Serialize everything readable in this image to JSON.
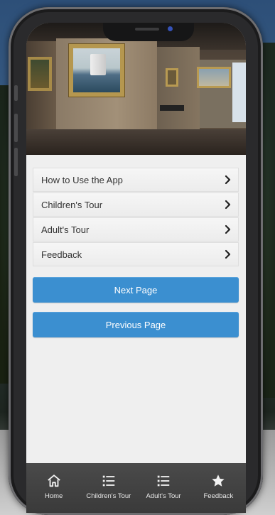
{
  "menu": {
    "items": [
      {
        "label": "How to Use the App",
        "icon": "chevron-right-icon"
      },
      {
        "label": "Children's Tour",
        "icon": "chevron-right-icon"
      },
      {
        "label": "Adult's Tour",
        "icon": "chevron-right-icon"
      },
      {
        "label": "Feedback",
        "icon": "chevron-right-icon"
      }
    ]
  },
  "buttons": {
    "next_label": "Next Page",
    "previous_label": "Previous Page"
  },
  "tabbar": {
    "tabs": [
      {
        "label": "Home",
        "icon": "home-icon"
      },
      {
        "label": "Children's Tour",
        "icon": "list-icon"
      },
      {
        "label": "Adult's Tour",
        "icon": "list-icon"
      },
      {
        "label": "Feedback",
        "icon": "star-icon"
      }
    ]
  },
  "colors": {
    "button_blue": "#3b8fd0",
    "tabbar_bg": "#3f3f3f",
    "screen_bg": "#efefef"
  }
}
